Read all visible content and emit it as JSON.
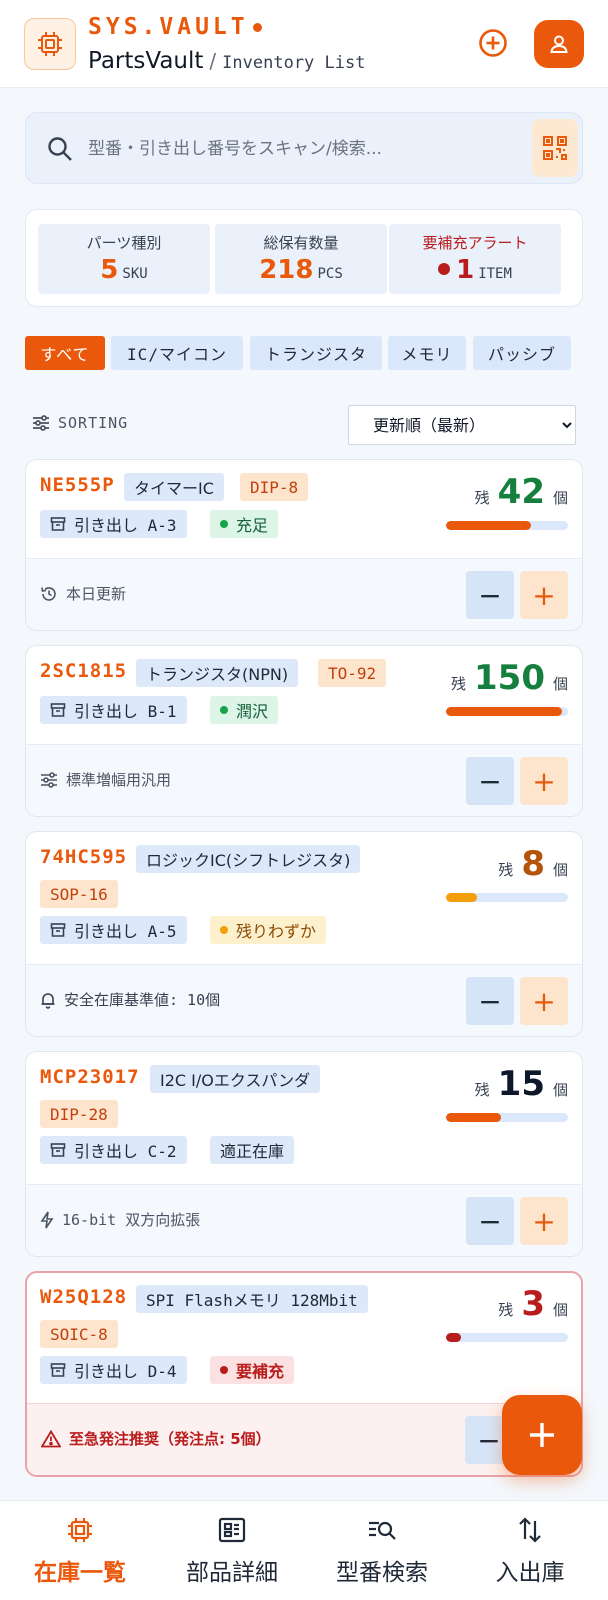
{
  "header": {
    "brand": "SYS.VAULT",
    "app_name": "PartsVault",
    "separator": "/",
    "subtitle": "Inventory List"
  },
  "search": {
    "placeholder": "型番・引き出し番号をスキャン/検索..."
  },
  "stats": [
    {
      "label": "パーツ種別",
      "value": "5",
      "unit": "SKU"
    },
    {
      "label": "総保有数量",
      "value": "218",
      "unit": "PCS"
    },
    {
      "label": "要補充アラート",
      "value": "1",
      "unit": "ITEM"
    }
  ],
  "filters": [
    "すべて",
    "IC/マイコン",
    "トランジスタ",
    "メモリ",
    "パッシブ"
  ],
  "sorting": {
    "label": "SORTING",
    "selected": "更新順（最新）"
  },
  "items": [
    {
      "pn": "NE555P",
      "category": "タイマーIC",
      "package": "DIP-8",
      "drawer": "引き出し A-3",
      "status": "充足",
      "remain_prefix": "残",
      "qty": "42",
      "unit": "個",
      "level": 0.7,
      "note": "本日更新"
    },
    {
      "pn": "2SC1815",
      "category": "トランジスタ(NPN)",
      "package": "TO-92",
      "drawer": "引き出し B-1",
      "status": "潤沢",
      "remain_prefix": "残",
      "qty": "150",
      "unit": "個",
      "level": 0.95,
      "note": "標準増幅用汎用"
    },
    {
      "pn": "74HC595",
      "category": "ロジックIC(シフトレジスタ)",
      "package": "SOP-16",
      "drawer": "引き出し A-5",
      "status": "残りわずか",
      "remain_prefix": "残",
      "qty": "8",
      "unit": "個",
      "level": 0.25,
      "note": "安全在庫基準値: 10個"
    },
    {
      "pn": "MCP23017",
      "category": "I2C I/Oエクスパンダ",
      "package": "DIP-28",
      "drawer": "引き出し C-2",
      "status": "適正在庫",
      "remain_prefix": "残",
      "qty": "15",
      "unit": "個",
      "level": 0.45,
      "note": "16-bit 双方向拡張"
    },
    {
      "pn": "W25Q128",
      "category": "SPI Flashメモリ 128Mbit",
      "package": "SOIC-8",
      "drawer": "引き出し D-4",
      "status": "要補充",
      "remain_prefix": "残",
      "qty": "3",
      "unit": "個",
      "level": 0.12,
      "note": "至急発注推奨（発注点: 5個）"
    }
  ],
  "buttons": {
    "minus": "−",
    "plus": "+"
  },
  "nav": [
    {
      "label": "在庫一覧"
    },
    {
      "label": "部品詳細"
    },
    {
      "label": "型番検索"
    },
    {
      "label": "入出庫"
    }
  ],
  "colors": {
    "accent": "#ea580c",
    "ok": "#15803d",
    "warning": "#f59e0b",
    "critical": "#b91c1c"
  },
  "icons": {
    "logo": "chip-icon",
    "add": "plus-circle-icon",
    "profile": "user-icon",
    "search": "search-icon",
    "scan": "qr-code-icon",
    "sort": "sliders-icon",
    "drawer": "archive-box-icon"
  }
}
